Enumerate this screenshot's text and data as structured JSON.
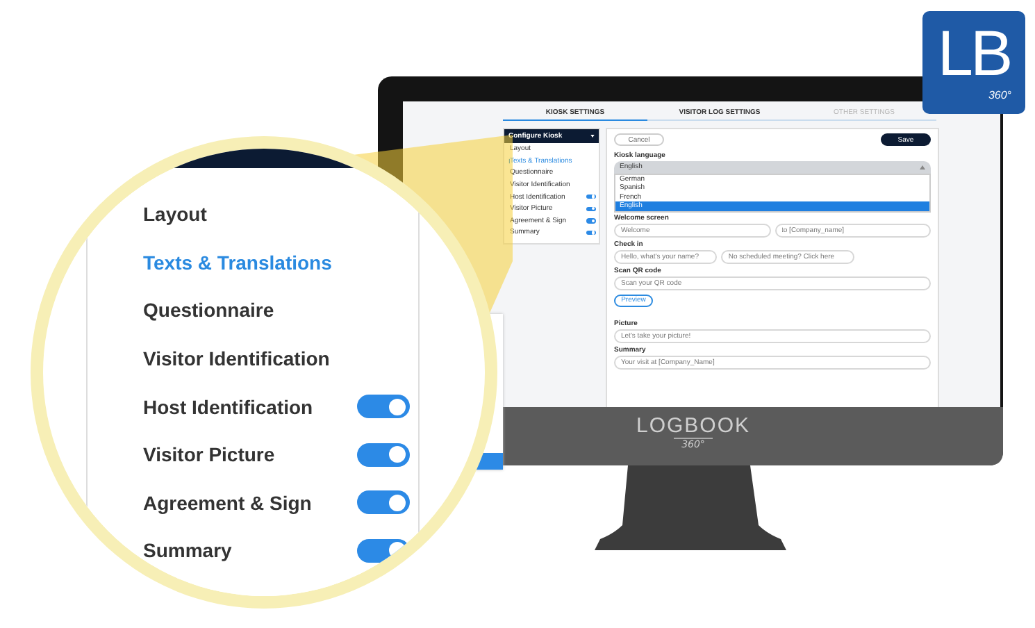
{
  "logo": {
    "text": "LB",
    "sub": "360°"
  },
  "monitor": {
    "brand": "LOGBOOK",
    "brand_sub": "360°"
  },
  "screen": {
    "tabs": [
      {
        "label": "KIOSK SETTINGS",
        "selected": true,
        "disabled": false
      },
      {
        "label": "VISITOR LOG SETTINGS",
        "selected": false,
        "disabled": false
      },
      {
        "label": "OTHER SETTINGS",
        "selected": false,
        "disabled": true
      }
    ],
    "sidebar": {
      "title": "Configure Kiosk",
      "items": [
        {
          "label": "Layout",
          "kind": "plain",
          "selected": false
        },
        {
          "label": "Texts & Translations",
          "kind": "plain",
          "selected": true
        },
        {
          "label": "Questionnaire",
          "kind": "plain",
          "selected": false
        },
        {
          "label": "Visitor Identification",
          "kind": "plain",
          "selected": false
        },
        {
          "label": "Host Identification",
          "kind": "toggle",
          "selected": false,
          "on": true
        },
        {
          "label": "Visitor Picture",
          "kind": "toggle",
          "selected": false,
          "on": true
        },
        {
          "label": "Agreement & Sign",
          "kind": "toggle",
          "selected": false,
          "on": true
        },
        {
          "label": "Summary",
          "kind": "toggle",
          "selected": false,
          "on": true
        }
      ]
    },
    "form": {
      "cancel": "Cancel",
      "save": "Save",
      "language": {
        "label": "Kiosk language",
        "value": "English",
        "expanded": true,
        "options": [
          {
            "label": "German",
            "selected": false
          },
          {
            "label": "Spanish",
            "selected": false
          },
          {
            "label": "French",
            "selected": false
          },
          {
            "label": "English",
            "selected": true
          }
        ]
      },
      "sections": [
        {
          "label": "Welcome screen",
          "kind": "pair",
          "fields": [
            {
              "placeholder": "Welcome"
            },
            {
              "placeholder": "to [Company_name]"
            }
          ]
        },
        {
          "label": "Check in",
          "kind": "inline",
          "fields": [
            {
              "placeholder": "Hello, what's your name?"
            },
            {
              "placeholder": "No scheduled meeting? Click here"
            }
          ]
        },
        {
          "label": "Scan QR code",
          "kind": "single",
          "fields": [
            {
              "placeholder": "Scan your QR code"
            }
          ],
          "button": "Preview"
        },
        {
          "label": "Picture",
          "kind": "single",
          "fields": [
            {
              "placeholder": "Let's take your picture!"
            }
          ]
        },
        {
          "label": "Summary",
          "kind": "single",
          "fields": [
            {
              "placeholder": "Your visit at [Company_Name]"
            }
          ]
        }
      ]
    }
  },
  "magnifier": {
    "items": [
      {
        "label": "Layout",
        "kind": "plain",
        "selected": false
      },
      {
        "label": "Texts & Translations",
        "kind": "plain",
        "selected": true
      },
      {
        "label": "Questionnaire",
        "kind": "plain",
        "selected": false
      },
      {
        "label": "Visitor Identification",
        "kind": "plain",
        "selected": false
      },
      {
        "label": "Host Identification",
        "kind": "toggle",
        "selected": false,
        "on": true
      },
      {
        "label": "Visitor Picture",
        "kind": "toggle",
        "selected": false,
        "on": true
      },
      {
        "label": "Agreement & Sign",
        "kind": "toggle",
        "selected": false,
        "on": true
      },
      {
        "label": "Summary",
        "kind": "toggle",
        "selected": false,
        "on": true
      }
    ]
  }
}
